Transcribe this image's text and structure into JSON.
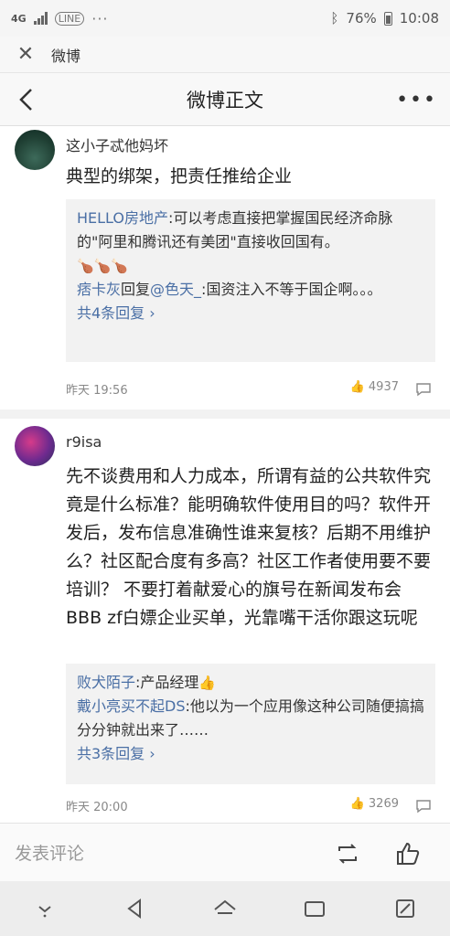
{
  "status_bar": {
    "network": "4G",
    "battery": "76%",
    "time": "10:08"
  },
  "browser": {
    "title": "微博"
  },
  "nav": {
    "title": "微博正文"
  },
  "comments": [
    {
      "username": "这小子忒他妈坏",
      "text": "典型的绑架，把责任推给企业",
      "replies": [
        {
          "name": "HELLO房地产",
          "text": ":可以考虑直接把掌握国民经济命脉的\"阿里和腾讯还有美团\"直接收回国有。",
          "emoji": "🍗🍗🍗"
        },
        {
          "name": "痞卡灰",
          "text_prefix": "回复",
          "mention": "@色天_",
          "text": ":国资注入不等于国企啊。。。"
        }
      ],
      "more": "共4条回复",
      "time": "昨天 19:56",
      "likes": "4937"
    },
    {
      "username": "r9isa",
      "text": "先不谈费用和人力成本，所谓有益的公共软件究竟是什么标准？能明确软件使用目的吗？软件开发后，发布信息准确性谁来复核？后期不用维护么？社区配合度有多高？社区工作者使用要不要培训？ 不要打着献爱心的旗号在新闻发布会BBB zf白嫖企业买单，光靠嘴干活你跟这玩呢",
      "replies": [
        {
          "name": "败犬陌子",
          "text": ":产品经理",
          "emoji": "👍"
        },
        {
          "name": "戴小亮买不起DS",
          "text": ":他以为一个应用像这种公司随便搞搞分分钟就出来了……"
        }
      ],
      "more": "共3条回复",
      "time": "昨天 20:00",
      "likes": "3269"
    }
  ],
  "input": {
    "placeholder": "发表评论"
  }
}
